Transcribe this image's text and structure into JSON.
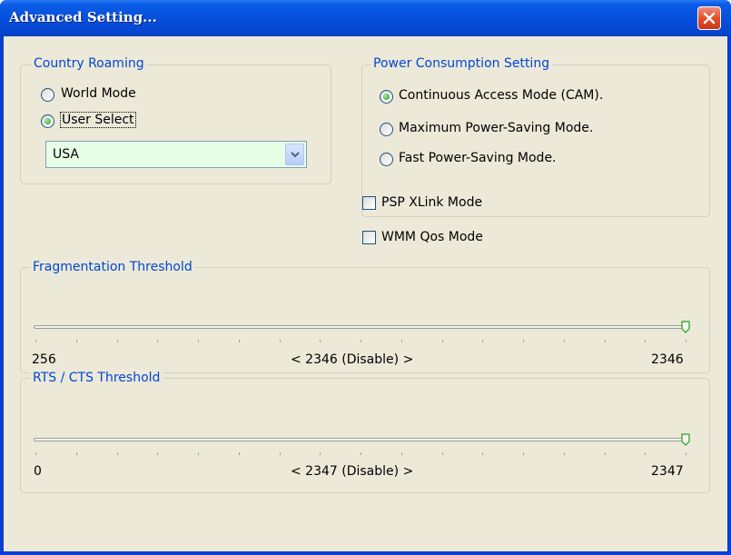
{
  "window": {
    "title": "Advanced Setting..."
  },
  "country_roaming": {
    "legend": "Country Roaming",
    "options": [
      "World Mode",
      "User Select"
    ],
    "selected": "User Select",
    "country": "USA"
  },
  "power": {
    "legend": "Power Consumption Setting",
    "options": [
      "Continuous Access Mode (CAM).",
      "Maximum Power-Saving Mode.",
      "Fast Power-Saving Mode."
    ],
    "selected": "Continuous Access Mode (CAM)."
  },
  "checkboxes": {
    "psp_xlink": {
      "label": "PSP XLink Mode",
      "checked": false
    },
    "wmm_qos": {
      "label": "WMM Qos Mode",
      "checked": false
    }
  },
  "fragmentation": {
    "legend": "Fragmentation Threshold",
    "min": "256",
    "max": "2346",
    "current": "< 2346 (Disable) >",
    "value": 2346
  },
  "rts_cts": {
    "legend": "RTS / CTS Threshold",
    "min": "0",
    "max": "2347",
    "current": "< 2347 (Disable) >",
    "value": 2347
  },
  "colors": {
    "accent": "#0046d5",
    "title_bar": "#0650dc",
    "dialog_bg": "#ece9d8",
    "combo_bg": "#e6ffe6"
  },
  "icons": {
    "close": "close-icon",
    "dropdown": "chevron-down-icon",
    "slider_thumb": "slider-thumb-icon"
  }
}
